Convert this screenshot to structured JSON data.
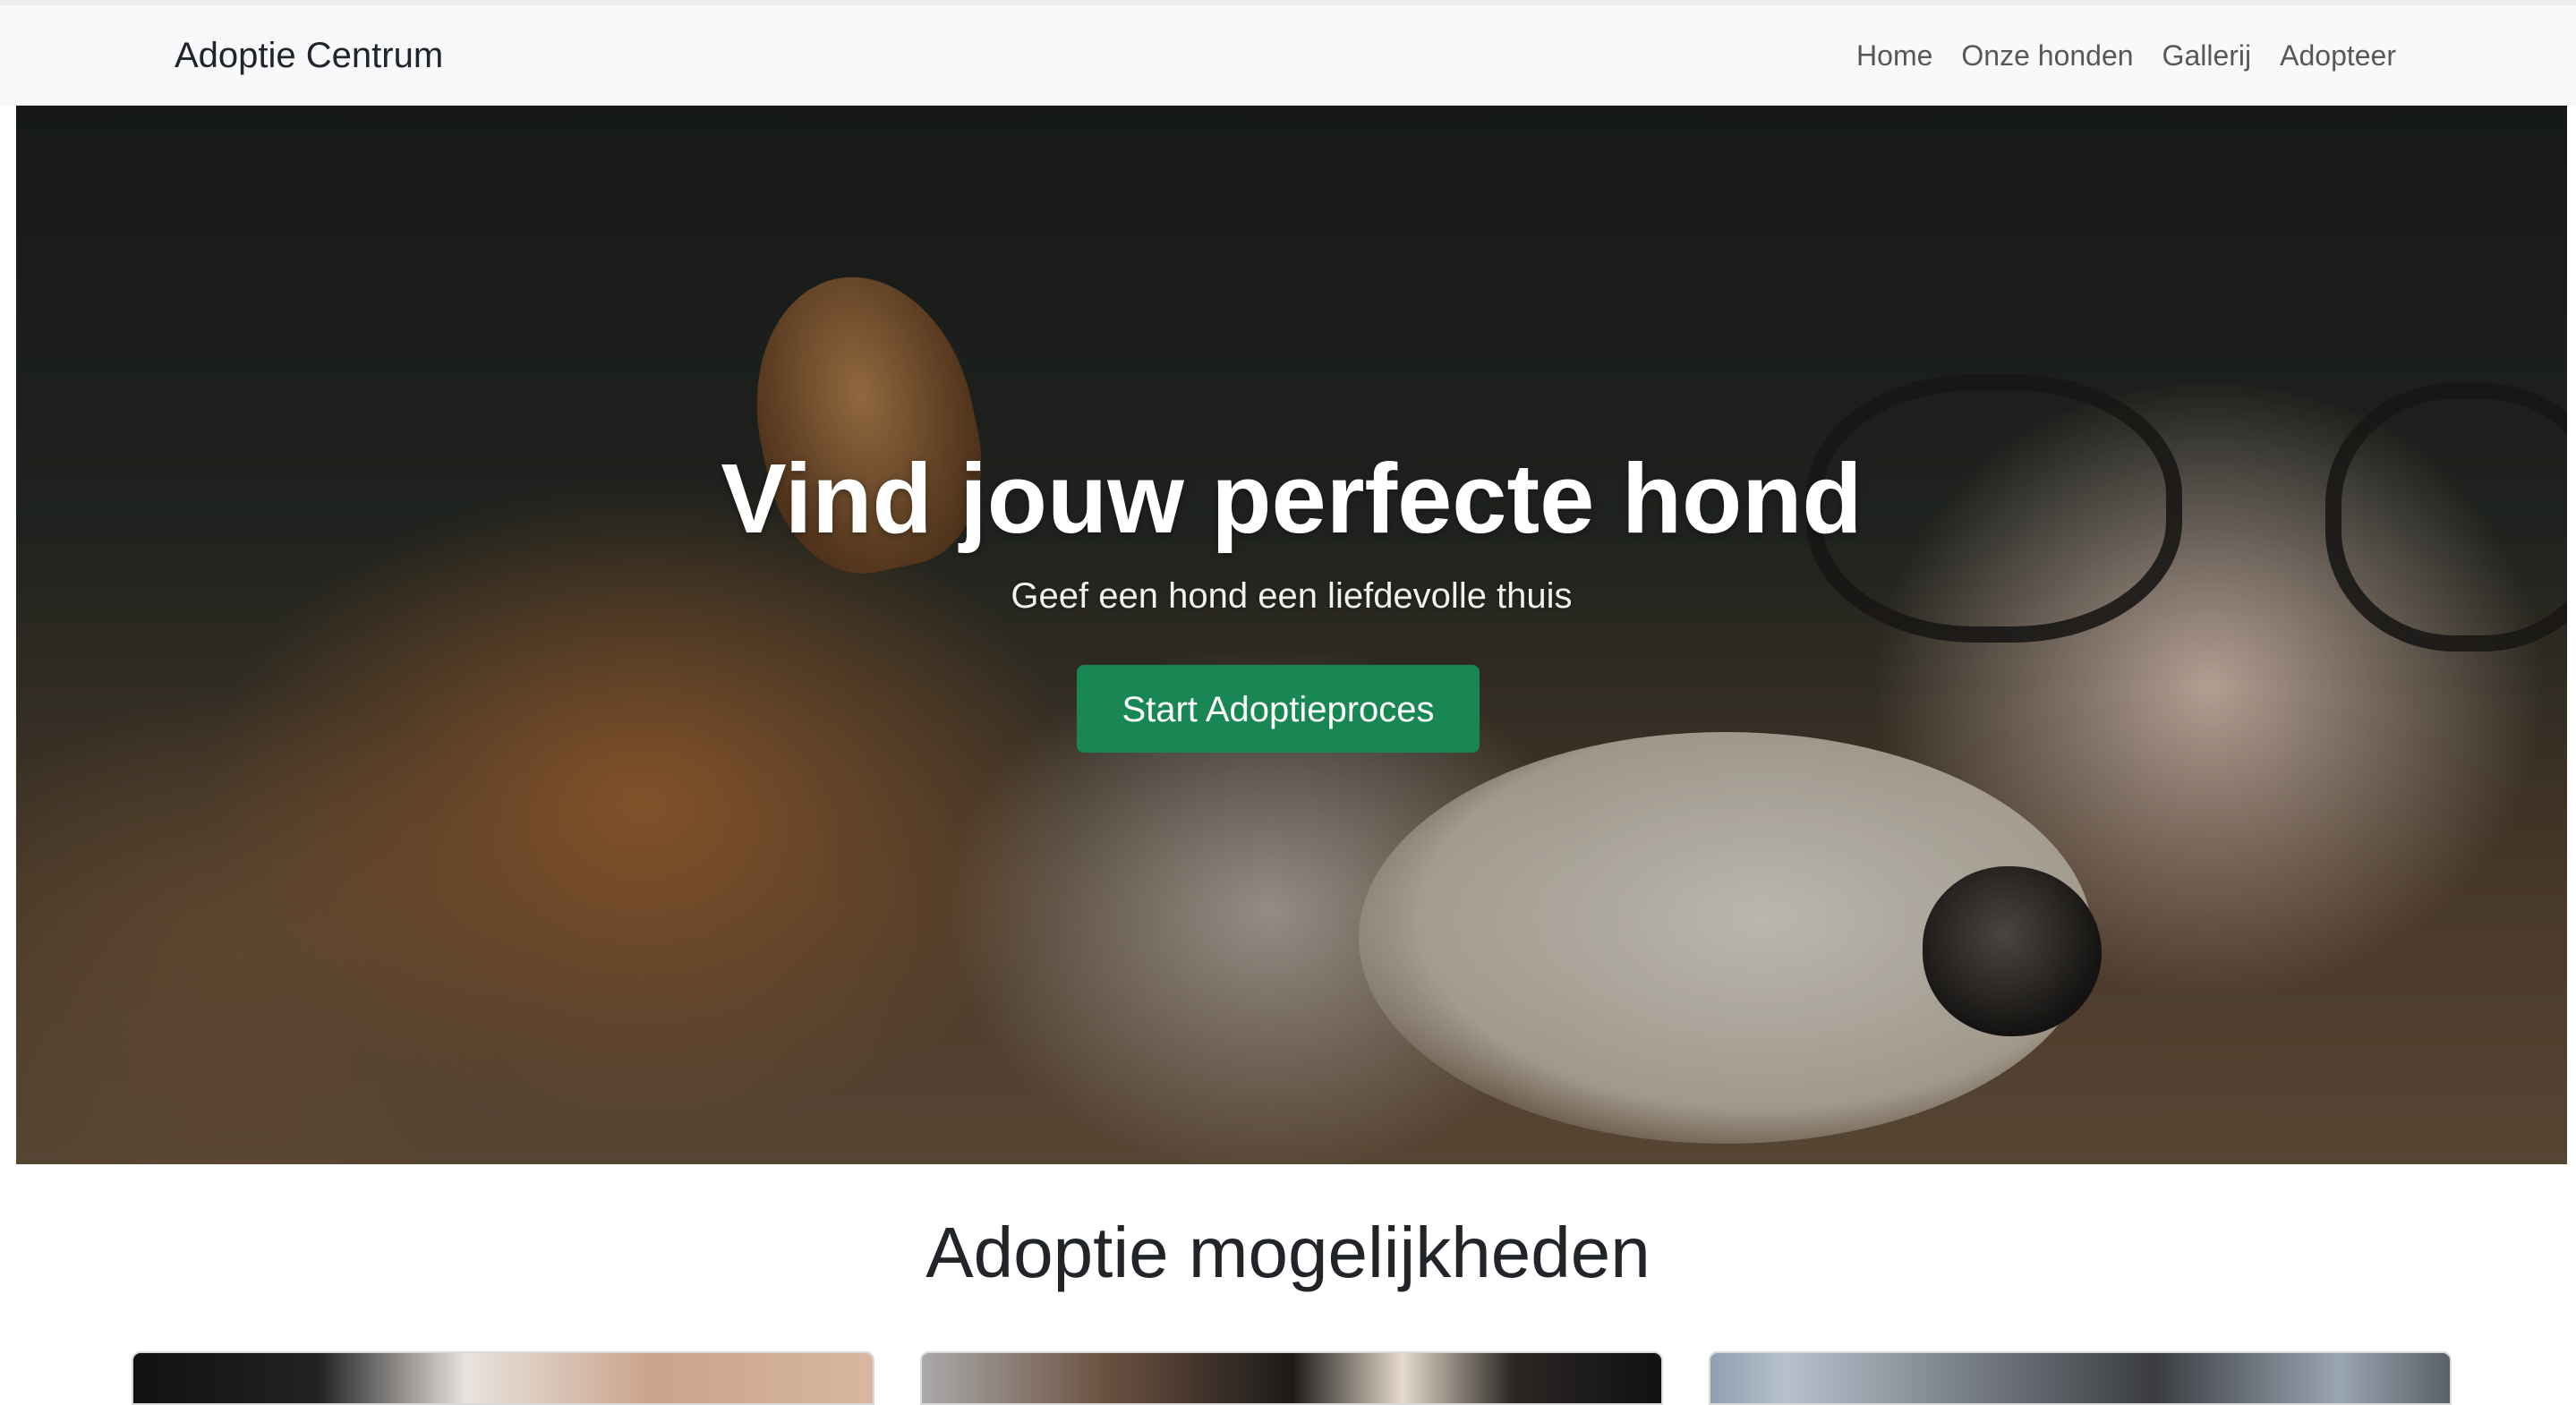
{
  "navbar": {
    "brand": "Adoptie Centrum",
    "links": [
      "Home",
      "Onze honden",
      "Gallerij",
      "Adopteer"
    ]
  },
  "hero": {
    "title": "Vind jouw perfecte hond",
    "subtitle": "Geef een hond een liefdevolle thuis",
    "button_label": "Start Adoptieproces",
    "button_color": "#198754"
  },
  "section": {
    "title": "Adoptie mogelijkheden",
    "cards": [
      {
        "image": "dog-photo"
      },
      {
        "image": "dog-photo"
      },
      {
        "image": "dog-photo"
      }
    ]
  }
}
